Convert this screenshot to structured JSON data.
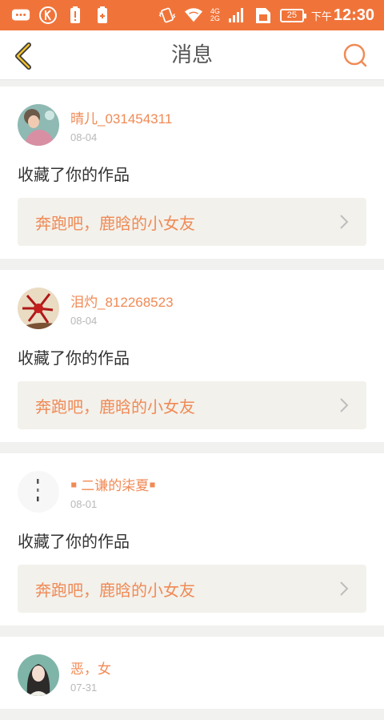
{
  "status_bar": {
    "time_prefix": "下午",
    "time": "12:30",
    "battery": "25",
    "network": [
      "4G",
      "2G"
    ]
  },
  "header": {
    "title": "消息"
  },
  "colors": {
    "accent": "#f0743a",
    "link_text": "#f08a55",
    "card_bg": "#ffffff",
    "page_bg": "#f1f1ef",
    "work_bg": "#f2f1ec"
  },
  "messages": [
    {
      "username": "晴儿_031454311",
      "date": "08-04",
      "action": "收藏了你的作品",
      "work_title": "奔跑吧，鹿晗的小女友"
    },
    {
      "username": "泪灼_812268523",
      "date": "08-04",
      "action": "收藏了你的作品",
      "work_title": "奔跑吧，鹿晗的小女友"
    },
    {
      "username": "￭ 二谦的柒夏￭",
      "date": "08-01",
      "action": "收藏了你的作品",
      "work_title": "奔跑吧，鹿晗的小女友"
    },
    {
      "username": "恶，女",
      "date": "07-31",
      "action": "",
      "work_title": ""
    }
  ]
}
